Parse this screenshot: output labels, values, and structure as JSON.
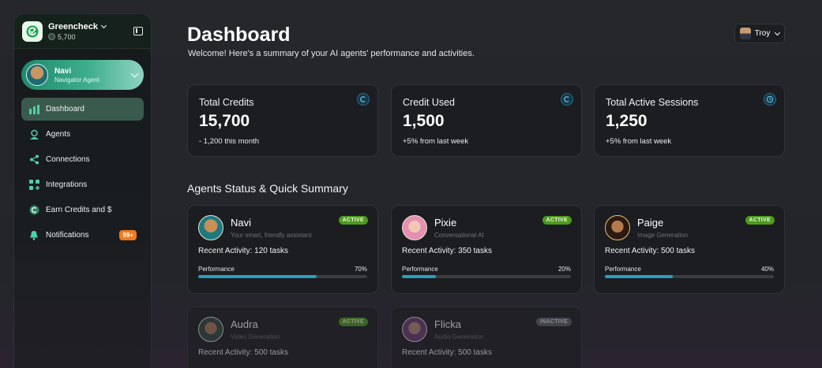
{
  "org": {
    "name": "Greencheck",
    "credits": "5,700"
  },
  "agent_selector": {
    "name": "Navi",
    "role": "Navigator Agent"
  },
  "nav": [
    {
      "label": "Dashboard",
      "icon": "bar-chart-icon",
      "active": true
    },
    {
      "label": "Agents",
      "icon": "agent-icon"
    },
    {
      "label": "Connections",
      "icon": "connections-icon"
    },
    {
      "label": "Integrations",
      "icon": "integrations-icon"
    },
    {
      "label": "Earn Credits and $",
      "icon": "coin-icon"
    },
    {
      "label": "Notifications",
      "icon": "bell-icon",
      "badge": "99+"
    }
  ],
  "header": {
    "title": "Dashboard",
    "subtitle": "Welcome! Here's a summary of your AI agents' performance and activities.",
    "user": "Troy"
  },
  "stats": [
    {
      "label": "Total Credits",
      "value": "15,700",
      "delta": "- 1,200 this month",
      "icon": "credit-coin-icon"
    },
    {
      "label": "Credit Used",
      "value": "1,500",
      "delta": "+5% from last week",
      "icon": "credit-coin-icon"
    },
    {
      "label": "Total Active Sessions",
      "value": "1,250",
      "delta": "+5% from last week",
      "icon": "clock-icon"
    }
  ],
  "section_title": "Agents Status & Quick Summary",
  "performance_label": "Performance",
  "agents": [
    {
      "name": "Navi",
      "desc": "Your smart, friendly assistant",
      "status": "ACTIVE",
      "activity": "Recent Activity: 120 tasks",
      "performance": "70%",
      "performance_value": 0.7
    },
    {
      "name": "Pixie",
      "desc": "Conversational AI",
      "status": "ACTIVE",
      "activity": "Recent Activity: 350 tasks",
      "performance": "20%",
      "performance_value": 0.2
    },
    {
      "name": "Paige",
      "desc": "Image Generation",
      "status": "ACTIVE",
      "activity": "Recent Activity: 500 tasks",
      "performance": "40%",
      "performance_value": 0.4
    },
    {
      "name": "Audra",
      "desc": "Video Generation",
      "status": "ACTIVE",
      "activity": "Recent Activity: 500 tasks"
    },
    {
      "name": "Flicka",
      "desc": "Audio Generation",
      "status": "INACTIVE",
      "activity": "Recent Activity: 500 tasks"
    }
  ],
  "colors": {
    "accent": "#3eae8c",
    "active_pill": "#4e9a1f",
    "progress": "#2a9ec0",
    "badge": "#f07a1e"
  }
}
